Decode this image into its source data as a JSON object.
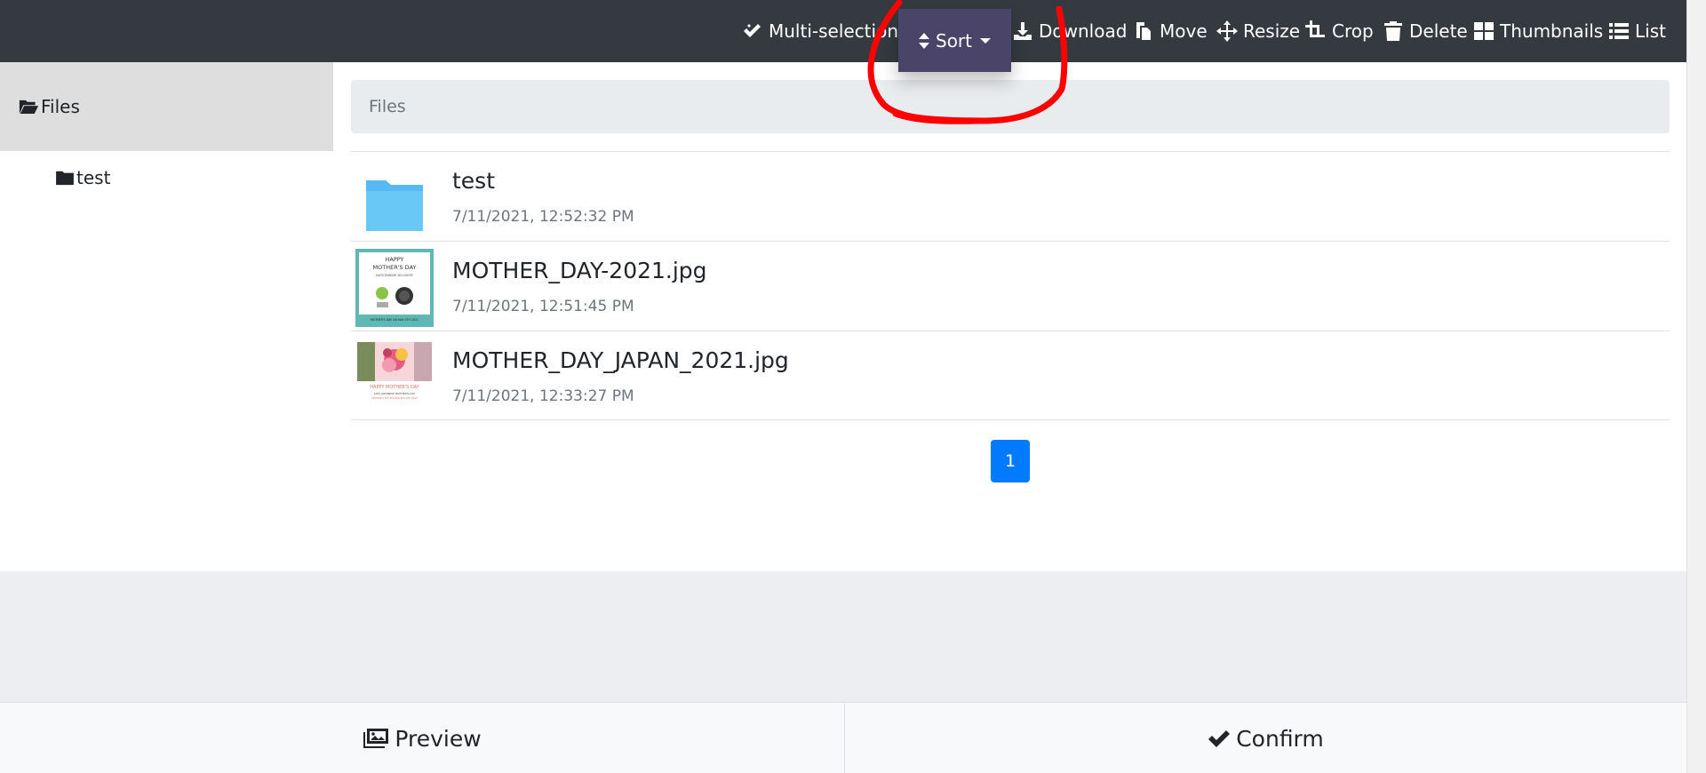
{
  "toolbar": {
    "multi_selection": "Multi-selection",
    "sort": "Sort",
    "download": "Download",
    "move": "Move",
    "resize": "Resize",
    "crop": "Crop",
    "delete": "Delete",
    "thumbnails": "Thumbnails",
    "list": "List"
  },
  "sidebar": {
    "root": "Files",
    "children": [
      {
        "label": "test"
      }
    ]
  },
  "breadcrumb": "Files",
  "files": [
    {
      "name": "test",
      "date": "7/11/2021, 12:52:32 PM",
      "kind": "folder"
    },
    {
      "name": "MOTHER_DAY-2021.jpg",
      "date": "7/11/2021, 12:51:45 PM",
      "kind": "image"
    },
    {
      "name": "MOTHER_DAY_JAPAN_2021.jpg",
      "date": "7/11/2021, 12:33:27 PM",
      "kind": "image"
    }
  ],
  "thumb1": {
    "line1": "HAPPY",
    "line2": "MOTHER'S DAY",
    "line3": "NATIONWIDE DELIVERY",
    "footer": "MOTHER'S DAY ON MAY 9TH 2021"
  },
  "thumb2": {
    "line1": "HAPPY MOTHER'S DAY",
    "line2": "2021 JAPANESE MOTHER'S DAY",
    "line3": "MOTHER'S DAY IN JAPAN MAY 9TH 2021"
  },
  "pagination": {
    "current": "1"
  },
  "footer": {
    "preview": "Preview",
    "confirm": "Confirm"
  },
  "colors": {
    "toolbar_bg": "#343a40",
    "sort_bg": "#4a4568",
    "pager_active": "#007bff",
    "annotation": "#ff0000",
    "folder": "#6ac8f7"
  }
}
